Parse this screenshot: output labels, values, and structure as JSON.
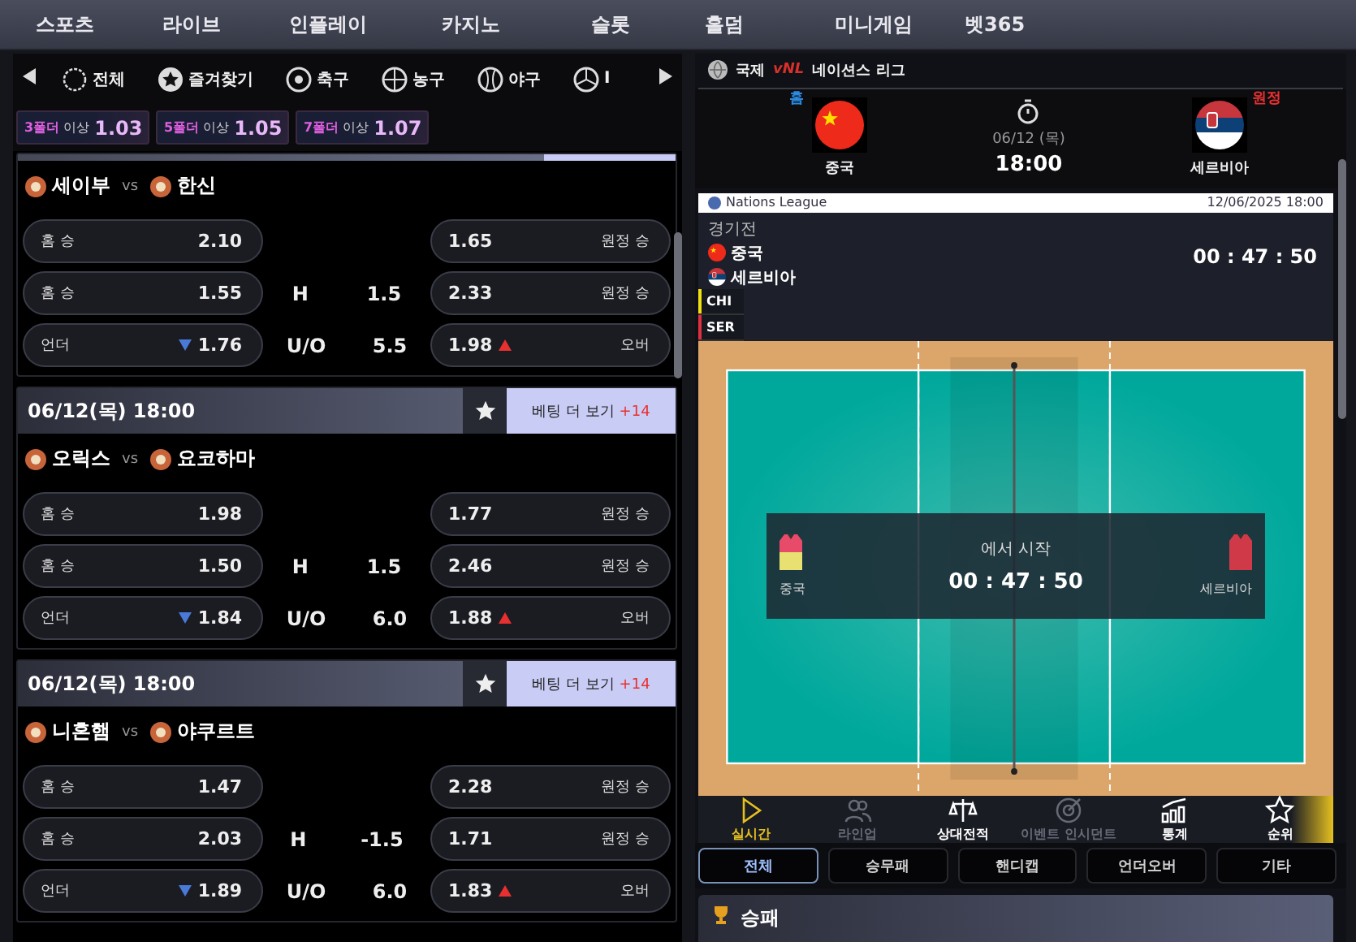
{
  "nav": [
    {
      "label": "스포츠"
    },
    {
      "label": "라이브"
    },
    {
      "label": "인플레이"
    },
    {
      "label": "카지노"
    },
    {
      "label": "슬롯"
    },
    {
      "label": "홀덤"
    },
    {
      "label": "미니게임"
    },
    {
      "label": "벳365"
    }
  ],
  "sport_tabs": [
    {
      "kind": "all",
      "label": "전체"
    },
    {
      "kind": "favorite",
      "label": "즐겨찾기"
    },
    {
      "kind": "soccer",
      "label": "축구"
    },
    {
      "kind": "basketball",
      "label": "농구"
    },
    {
      "kind": "baseball",
      "label": "야구"
    },
    {
      "kind": "volleyball",
      "label": "I"
    }
  ],
  "bonus_chips": [
    {
      "folder": "3폴더",
      "suffix": "이상",
      "odds": "1.03"
    },
    {
      "folder": "5폴더",
      "suffix": "이상",
      "odds": "1.05"
    },
    {
      "folder": "7폴더",
      "suffix": "이상",
      "odds": "1.07"
    }
  ],
  "matches": [
    {
      "home": "세이부",
      "vs": "vs",
      "away": "한신",
      "rows": [
        {
          "left_label": "홈 승",
          "left_odds": "2.10",
          "right_odds": "1.65",
          "right_label": "원정 승"
        },
        {
          "left_label": "홈 승",
          "left_odds": "1.55",
          "mid_label": "H",
          "mid_value": "1.5",
          "right_odds": "2.33",
          "right_label": "원정 승"
        },
        {
          "left_label": "언더",
          "left_odds": "1.76",
          "left_falling": true,
          "mid_label": "U/O",
          "mid_value": "5.5",
          "right_odds": "1.98",
          "right_rising": true,
          "right_label": "오버"
        }
      ]
    },
    {
      "date": "06/12(목) 18:00",
      "more_label": "베팅 더 보기",
      "more_count": "+14",
      "home": "오릭스",
      "vs": "vs",
      "away": "요코하마",
      "rows": [
        {
          "left_label": "홈 승",
          "left_odds": "1.98",
          "right_odds": "1.77",
          "right_label": "원정 승"
        },
        {
          "left_label": "홈 승",
          "left_odds": "1.50",
          "mid_label": "H",
          "mid_value": "1.5",
          "right_odds": "2.46",
          "right_label": "원정 승"
        },
        {
          "left_label": "언더",
          "left_odds": "1.84",
          "left_falling": true,
          "mid_label": "U/O",
          "mid_value": "6.0",
          "right_odds": "1.88",
          "right_rising": true,
          "right_label": "오버"
        }
      ]
    },
    {
      "date": "06/12(목) 18:00",
      "more_label": "베팅 더 보기",
      "more_count": "+14",
      "home": "니혼햄",
      "vs": "vs",
      "away": "야쿠르트",
      "rows": [
        {
          "left_label": "홈 승",
          "left_odds": "1.47",
          "right_odds": "2.28",
          "right_label": "원정 승"
        },
        {
          "left_label": "홈 승",
          "left_odds": "2.03",
          "mid_label": "H",
          "mid_value": "-1.5",
          "right_odds": "1.71",
          "right_label": "원정 승"
        },
        {
          "left_label": "언더",
          "left_odds": "1.89",
          "left_falling": true,
          "mid_label": "U/O",
          "mid_value": "6.0",
          "right_odds": "1.83",
          "right_rising": true,
          "right_label": "오버"
        }
      ]
    }
  ],
  "detail": {
    "region": "국제",
    "league_logo": "vNL",
    "league": "네이션스 리그",
    "home": {
      "side_label": "홈",
      "name": "중국",
      "kind": "china"
    },
    "away": {
      "side_label": "원정",
      "name": "세르비아",
      "kind": "serbia"
    },
    "date": "06/12 (목)",
    "time": "18:00",
    "banner": {
      "title": "Nations League",
      "datetime": "12/06/2025 18:00"
    },
    "scoreboard": {
      "status": "경기전",
      "teams": [
        {
          "kind": "china",
          "name": "중국"
        },
        {
          "kind": "serbia",
          "name": "세르비아"
        }
      ],
      "timer": "00 : 47 : 50",
      "codes": [
        {
          "code": "CHI",
          "color": "#f0e010"
        },
        {
          "code": "SER",
          "color": "#e03040"
        }
      ]
    },
    "court": {
      "caption": "에서 시작",
      "timer": "00 : 47 : 50",
      "home": "중국",
      "away": "세르비아"
    },
    "tabs": [
      {
        "kind": "live",
        "label": "실시간",
        "selected": true,
        "disabled": false
      },
      {
        "kind": "lineup",
        "label": "라인업",
        "selected": false,
        "disabled": true
      },
      {
        "kind": "h2h",
        "label": "상대전적",
        "selected": false,
        "disabled": false
      },
      {
        "kind": "incident",
        "label": "이벤트 인시던트",
        "selected": false,
        "disabled": true
      },
      {
        "kind": "stats",
        "label": "통계",
        "selected": false,
        "disabled": false
      },
      {
        "kind": "rank",
        "label": "순위",
        "selected": false,
        "disabled": false
      }
    ],
    "filters": [
      {
        "label": "전체",
        "selected": true
      },
      {
        "label": "승무패",
        "selected": false
      },
      {
        "label": "핸디캡",
        "selected": false
      },
      {
        "label": "언더오버",
        "selected": false
      },
      {
        "label": "기타",
        "selected": false
      }
    ],
    "section": {
      "title": "승패"
    }
  }
}
